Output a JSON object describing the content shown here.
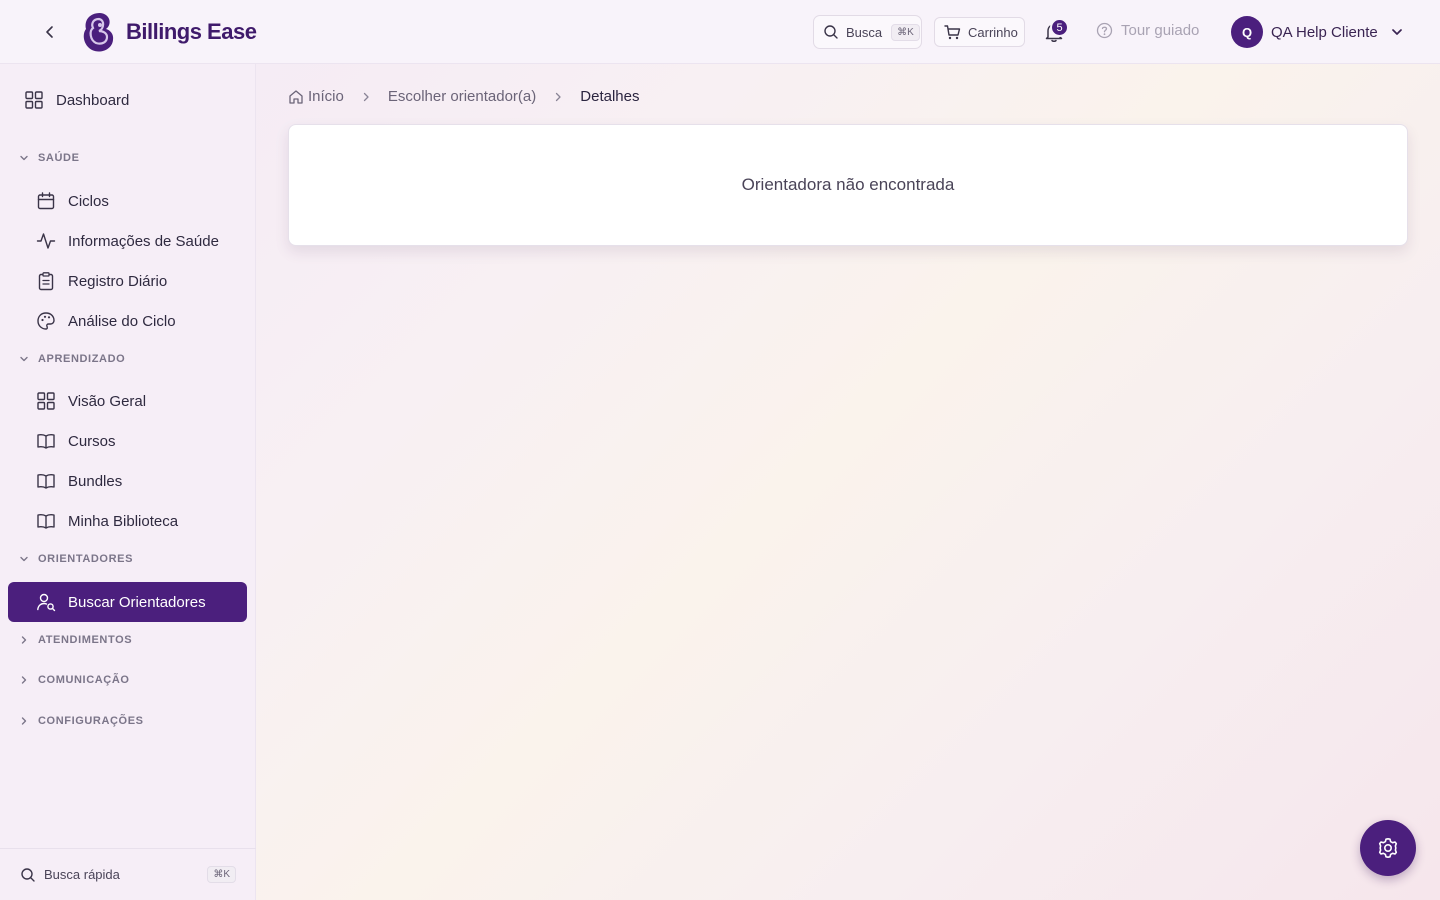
{
  "app": {
    "name": "Billings Ease"
  },
  "header": {
    "search_label": "Busca",
    "search_shortcut": "⌘K",
    "cart_label": "Carrinho",
    "notifications_count": "5",
    "tour_label": "Tour guiado",
    "user_initial": "Q",
    "user_name": "QA Help Cliente"
  },
  "sidebar": {
    "dashboard": "Dashboard",
    "sections": {
      "saude": {
        "title": "SAÚDE",
        "items": [
          "Ciclos",
          "Informações de Saúde",
          "Registro Diário",
          "Análise do Ciclo"
        ]
      },
      "aprendizado": {
        "title": "APRENDIZADO",
        "items": [
          "Visão Geral",
          "Cursos",
          "Bundles",
          "Minha Biblioteca"
        ]
      },
      "orientadores": {
        "title": "ORIENTADORES",
        "items": [
          "Buscar Orientadores"
        ]
      },
      "atendimentos": {
        "title": "ATENDIMENTOS"
      },
      "comunicacao": {
        "title": "COMUNICAÇÃO"
      },
      "configuracoes": {
        "title": "CONFIGURAÇÕES"
      }
    },
    "quick_search_label": "Busca rápida",
    "quick_search_shortcut": "⌘K"
  },
  "breadcrumb": [
    "Início",
    "Escolher orientador(a)",
    "Detalhes"
  ],
  "main": {
    "message": "Orientadora não encontrada"
  },
  "colors": {
    "primary": "#4b1f7d",
    "text": "#2b2540",
    "muted": "#7b7589"
  },
  "icons": {
    "back": "chevron-left-icon",
    "logo": "logo-icon",
    "search": "search-icon",
    "cart": "cart-icon",
    "bell": "bell-icon",
    "tour": "help-circle-icon",
    "user_menu": "chevron-down-icon",
    "settings_fab": "gear-icon"
  }
}
